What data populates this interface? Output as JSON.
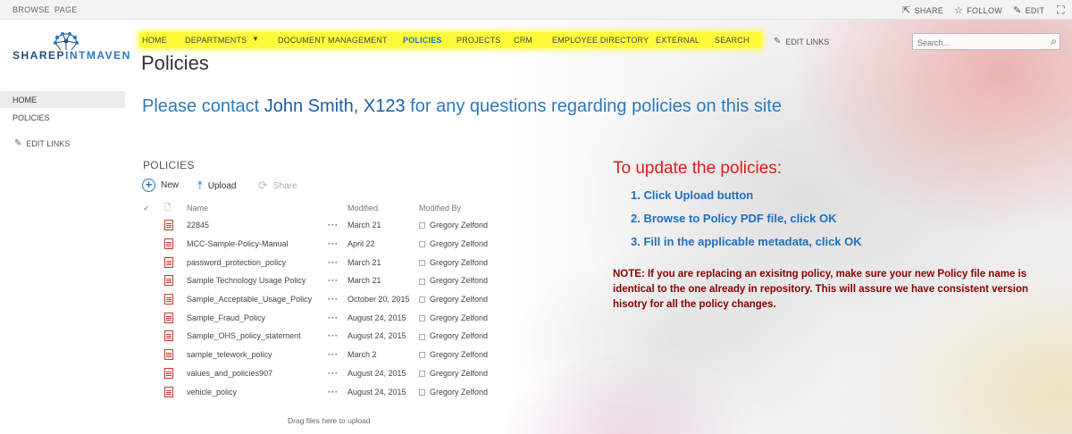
{
  "ribbon": {
    "tabs": [
      "BROWSE",
      "PAGE"
    ],
    "actions": [
      {
        "label": "SHARE",
        "icon": "share-icon"
      },
      {
        "label": "FOLLOW",
        "icon": "star-icon"
      },
      {
        "label": "EDIT",
        "icon": "pencil-icon"
      }
    ],
    "focus_icon": "focus-mode-icon"
  },
  "logo": {
    "text_a": "SHAREP",
    "text_b": "INTMAVEN"
  },
  "topnav": {
    "items": [
      "HOME",
      "DEPARTMENTS",
      "DOCUMENT MANAGEMENT",
      "POLICIES",
      "PROJECTS",
      "CRM",
      "EMPLOYEE DIRECTORY",
      "EXTERNAL",
      "SEARCH"
    ],
    "active": "POLICIES",
    "edit_links": "EDIT LINKS",
    "highlight_color": "#fffb3a"
  },
  "search": {
    "placeholder": "Search..."
  },
  "page_title": "Policies",
  "leftnav": {
    "home": "HOME",
    "policies": "POLICIES",
    "edit_links": "EDIT LINKS"
  },
  "contact": {
    "before": "Please contact ",
    "name": "John Smith, X123",
    "after": " for any questions regarding policies on this site"
  },
  "library": {
    "title": "POLICIES",
    "commands": {
      "new": "New",
      "upload": "Upload",
      "share": "Share"
    },
    "columns": {
      "name": "Name",
      "modified": "Modified",
      "modified_by": "Modified By"
    },
    "rows": [
      {
        "name": "22845",
        "modified": "March 21",
        "by": "Gregory Zelfond"
      },
      {
        "name": "MCC-Sample-Policy-Manual",
        "modified": "April 22",
        "by": "Gregory Zelfond"
      },
      {
        "name": "password_protection_policy",
        "modified": "March 21",
        "by": "Gregory Zelfond"
      },
      {
        "name": "Sample Technology Usage Policy",
        "modified": "March 21",
        "by": "Gregory Zelfond"
      },
      {
        "name": "Sample_Acceptable_Usage_Policy",
        "modified": "October 20, 2015",
        "by": "Gregory Zelfond"
      },
      {
        "name": "Sample_Fraud_Policy",
        "modified": "August 24, 2015",
        "by": "Gregory Zelfond"
      },
      {
        "name": "Sample_OHS_policy_statement",
        "modified": "August 24, 2015",
        "by": "Gregory Zelfond"
      },
      {
        "name": "sample_telework_policy",
        "modified": "March 2",
        "by": "Gregory Zelfond"
      },
      {
        "name": "values_and_policies907",
        "modified": "August 24, 2015",
        "by": "Gregory Zelfond"
      },
      {
        "name": "vehicle_policy",
        "modified": "August 24, 2015",
        "by": "Gregory Zelfond"
      }
    ],
    "drag_hint": "Drag files here to upload"
  },
  "instructions": {
    "title": "To update the policies:",
    "steps": [
      "1. Click Upload button",
      "2. Browse to Policy PDF file, click OK",
      "3. Fill in the applicable metadata, click OK"
    ],
    "note": "NOTE: If you are replacing an exisitng policy, make sure your new Policy file name is identical to the one already in repository. This will assure we have consistent version hisotry for all the policy changes."
  }
}
